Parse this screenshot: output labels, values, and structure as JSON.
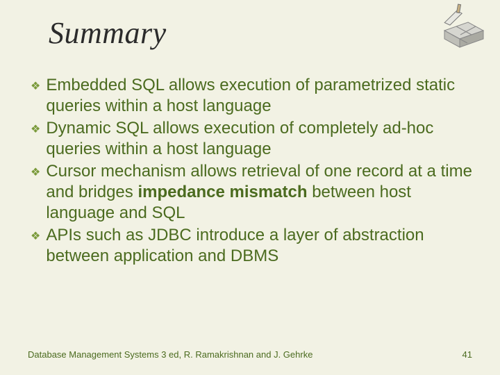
{
  "title": "Summary",
  "bullets": [
    {
      "pre": "Embedded SQL allows execution of parametrized static queries within a host language",
      "bold": "",
      "post": ""
    },
    {
      "pre": "Dynamic SQL allows execution of completely ad-hoc queries within a host language",
      "bold": "",
      "post": ""
    },
    {
      "pre": "Cursor mechanism allows retrieval of one record at a time and bridges ",
      "bold": "impedance mismatch",
      "post": " between host language and SQL"
    },
    {
      "pre": "APIs such as JDBC introduce a layer of abstraction between application and DBMS",
      "bold": "",
      "post": ""
    }
  ],
  "footer": {
    "left": "Database Management Systems 3 ed,  R. Ramakrishnan and J. Gehrke",
    "right": "41"
  },
  "bullet_glyph": "❖"
}
